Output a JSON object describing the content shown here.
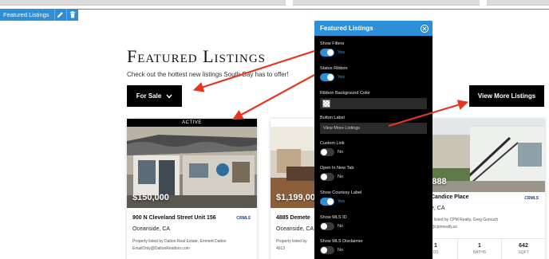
{
  "editor": {
    "widget_label": "Featured Listings",
    "edit_icon": "pencil-icon",
    "delete_icon": "trash-icon",
    "accent_color": "#2d8fd8"
  },
  "section": {
    "title": "Featured Listings",
    "subtitle": "Check out the hottest new listings South Bay has to offer!",
    "filter_label": "For Sale",
    "view_more_label": "View More Listings"
  },
  "cards": [
    {
      "ribbon": "ACTIVE",
      "price": "$150,000",
      "address": "900 N Cleveland Street Unit 156",
      "city": "Oceanside, CA",
      "listed_by": "Property listed by Dalton Real Estate, Emmett Dalton",
      "email": "EmailOnly@DaltonRealtors.com",
      "mls_logo": "CRMLS"
    },
    {
      "price": "$1,199,000",
      "address": "4885 Demete",
      "city": "Oceanside, CA",
      "listed_by": "Property listed by",
      "email": "4913"
    },
    {
      "price": "99,888",
      "address": "Candice Place",
      "city": "e, CA",
      "listed_by": "y listed by CPM Realty, Greg Gorsuch",
      "email": "@cpmrealty.us",
      "mls_logo": "CRMLS",
      "stats": [
        {
          "n": "1",
          "u": "DS"
        },
        {
          "n": "1",
          "u": "BATHS"
        },
        {
          "n": "642",
          "u": "SQFT"
        }
      ]
    }
  ],
  "panel": {
    "title": "Featured Listings",
    "show_filters": {
      "label": "Show Filters",
      "value": "Yes",
      "on": true
    },
    "status_ribbon": {
      "label": "Status Ribbon",
      "value": "Yes",
      "on": true
    },
    "ribbon_bg": {
      "label": "Ribbon Background Color"
    },
    "button_label": {
      "label": "Button Label",
      "value": "View More Listings"
    },
    "custom_link": {
      "label": "Custom Link",
      "value": "No",
      "on": false
    },
    "open_new_tab": {
      "label": "Open In New Tab",
      "value": "No",
      "on": false
    },
    "courtesy_label": {
      "label": "Show Courtesy Label",
      "value": "Yes",
      "on": true
    },
    "mls_id": {
      "label": "Show MLS ID",
      "value": "No",
      "on": false
    },
    "mls_disclaimer": {
      "label": "Show MLS Disclaimer",
      "value": "No",
      "on": false
    }
  },
  "annotation_color": "#e8341c"
}
